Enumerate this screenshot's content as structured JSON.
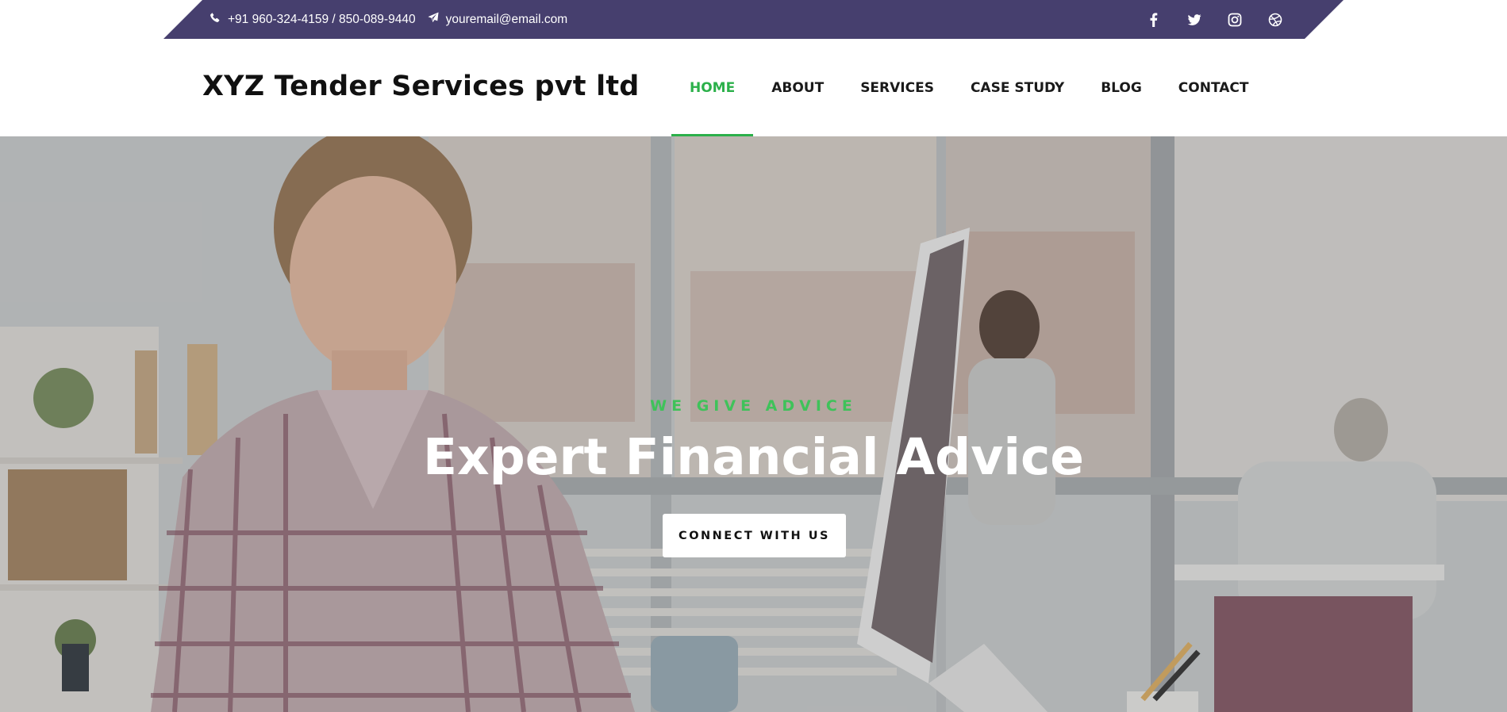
{
  "topbar": {
    "phone": "+91 960-324-4159 / 850-089-9440",
    "email": "youremail@email.com",
    "phone_icon": "phone-icon",
    "email_icon": "paper-plane-icon",
    "social": [
      "facebook-icon",
      "twitter-icon",
      "instagram-icon",
      "dribbble-icon"
    ],
    "background_color": "#463f6e"
  },
  "header": {
    "brand": "XYZ Tender Services pvt ltd",
    "nav": [
      {
        "label": "HOME",
        "active": true
      },
      {
        "label": "ABOUT",
        "active": false
      },
      {
        "label": "SERVICES",
        "active": false
      },
      {
        "label": "CASE STUDY",
        "active": false
      },
      {
        "label": "BLOG",
        "active": false
      },
      {
        "label": "CONTACT",
        "active": false
      }
    ],
    "active_color": "#2bb04a"
  },
  "hero": {
    "eyebrow": "WE GIVE ADVICE",
    "headline": "Expert Financial Advice",
    "cta_label": "CONNECT WITH US",
    "eyebrow_color": "#3fc25a"
  }
}
